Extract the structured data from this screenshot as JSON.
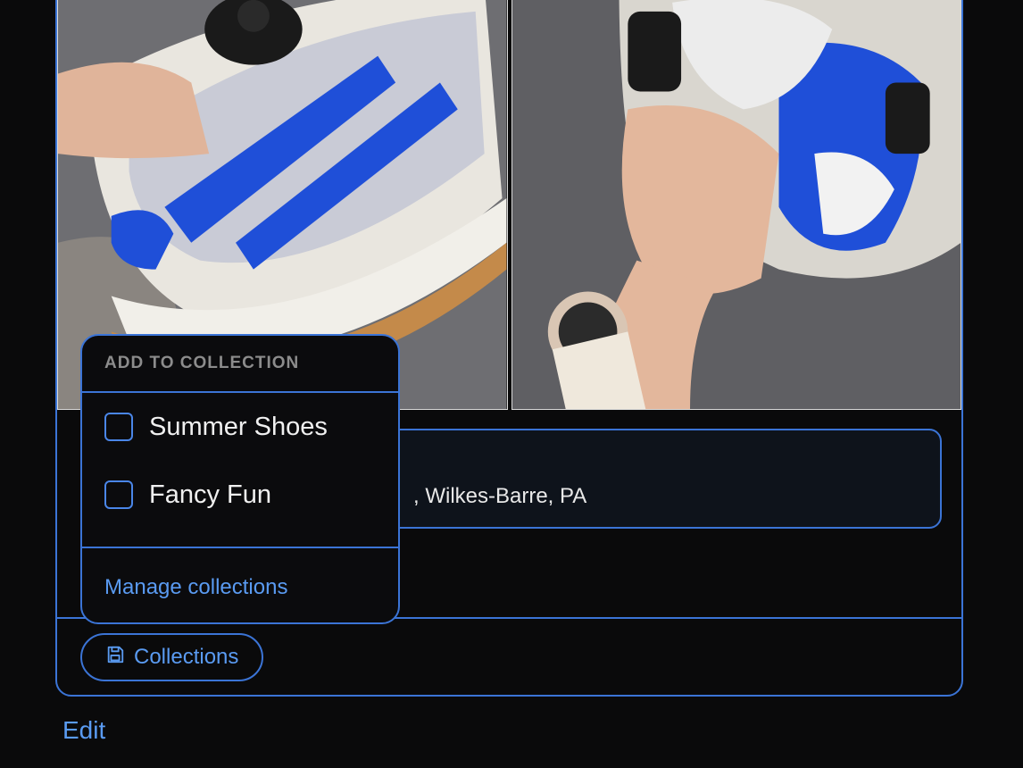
{
  "popover": {
    "heading": "ADD TO COLLECTION",
    "items": [
      {
        "label": "Summer Shoes",
        "checked": false
      },
      {
        "label": "Fancy Fun",
        "checked": false
      }
    ],
    "manage_label": "Manage collections"
  },
  "post": {
    "location_partial": ", Wilkes-Barre, PA",
    "collections_button": "Collections",
    "edit_label": "Edit"
  },
  "colors": {
    "accent": "#3b74d6",
    "link": "#5a9bf2",
    "background": "#0a0a0b"
  }
}
